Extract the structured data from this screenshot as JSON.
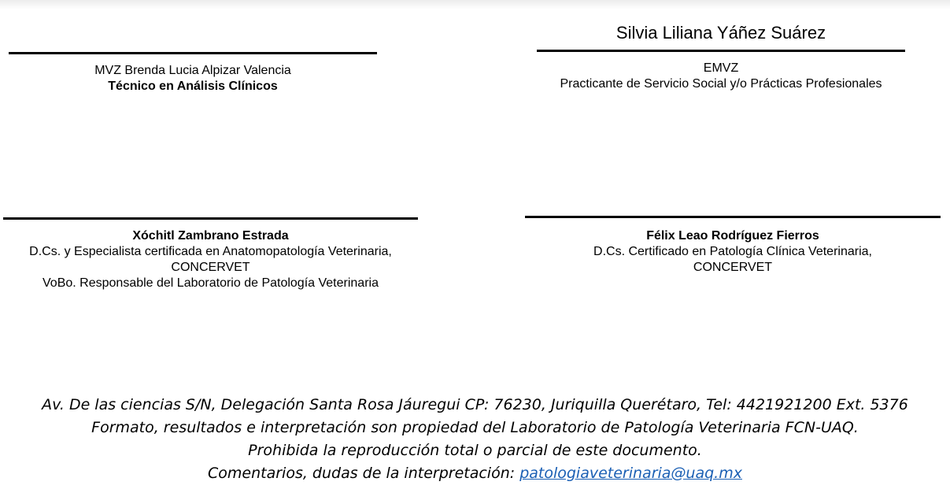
{
  "signatures": {
    "top_left": {
      "name": "MVZ Brenda Lucia Alpizar Valencia",
      "title": "Técnico en Análisis Clínicos"
    },
    "top_right": {
      "signature_name": "Silvia Liliana Yáñez Suárez",
      "degree": "EMVZ",
      "title": "Practicante de Servicio Social y/o Prácticas Profesionales"
    },
    "bottom_left": {
      "name": "Xóchitl Zambrano Estrada",
      "line1": "D.Cs. y Especialista certificada en Anatomopatología Veterinaria,",
      "line2": "CONCERVET",
      "line3": "VoBo. Responsable del Laboratorio de Patología Veterinaria"
    },
    "bottom_right": {
      "name": "Félix Leao Rodríguez Fierros",
      "line1": "D.Cs. Certificado en Patología Clínica Veterinaria,",
      "line2": "CONCERVET"
    }
  },
  "footer": {
    "address": "Av. De las ciencias S/N, Delegación Santa Rosa Jáuregui CP: 76230, Juriquilla Querétaro, Tel: 4421921200 Ext. 5376",
    "ownership": "Formato, resultados e interpretación son propiedad del Laboratorio de Patología Veterinaria FCN-UAQ.",
    "prohibition": "Prohibida la reproducción total o parcial de este documento.",
    "contact_prefix": "Comentarios, dudas de la interpretación:",
    "email": "patologiaveterinaria@uaq.mx",
    "link_color": "#1a5fb4"
  }
}
